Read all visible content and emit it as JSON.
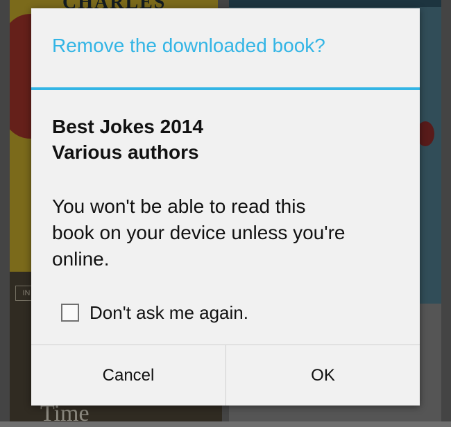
{
  "background": {
    "top_right_cover_title": "CHARLES",
    "bottom_left_cover_tag": "IN",
    "bottom_left_cover_title": "Time"
  },
  "dialog": {
    "title": "Remove the downloaded book?",
    "book_title": "Best Jokes 2014",
    "book_author": "Various authors",
    "message_lines": [
      "You won't be able to read this",
      "book on your device unless you're",
      "online."
    ],
    "checkbox": {
      "label": "Don't ask me again.",
      "checked": false
    },
    "buttons": {
      "cancel": "Cancel",
      "ok": "OK"
    }
  },
  "colors": {
    "accent": "#33b5e5",
    "dialog_background": "#f1f1f1",
    "text": "#111111"
  }
}
